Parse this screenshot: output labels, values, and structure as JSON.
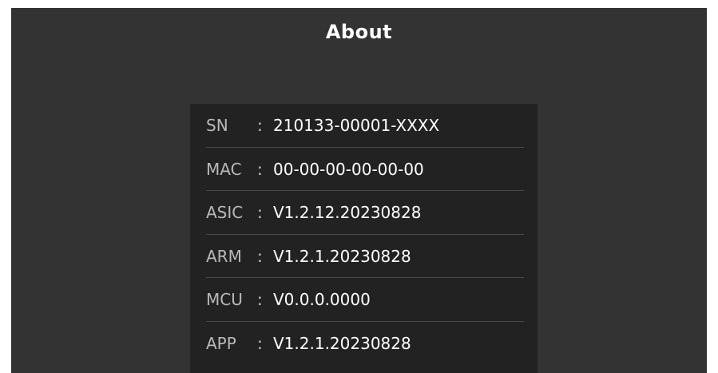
{
  "page": {
    "title": "About"
  },
  "info": {
    "separator": ":",
    "rows": [
      {
        "label": "SN",
        "value": "210133-00001-XXXX"
      },
      {
        "label": "MAC",
        "value": "00-00-00-00-00-00"
      },
      {
        "label": "ASIC",
        "value": "V1.2.12.20230828"
      },
      {
        "label": "ARM",
        "value": "V1.2.1.20230828"
      },
      {
        "label": "MCU",
        "value": "V0.0.0.0000"
      },
      {
        "label": "APP",
        "value": "V1.2.1.20230828"
      }
    ]
  },
  "colors": {
    "screen_background": "#333333",
    "panel_background": "#222222",
    "divider": "#4a4a4a",
    "label_text": "#b9b9b9",
    "value_text": "#ffffff"
  }
}
